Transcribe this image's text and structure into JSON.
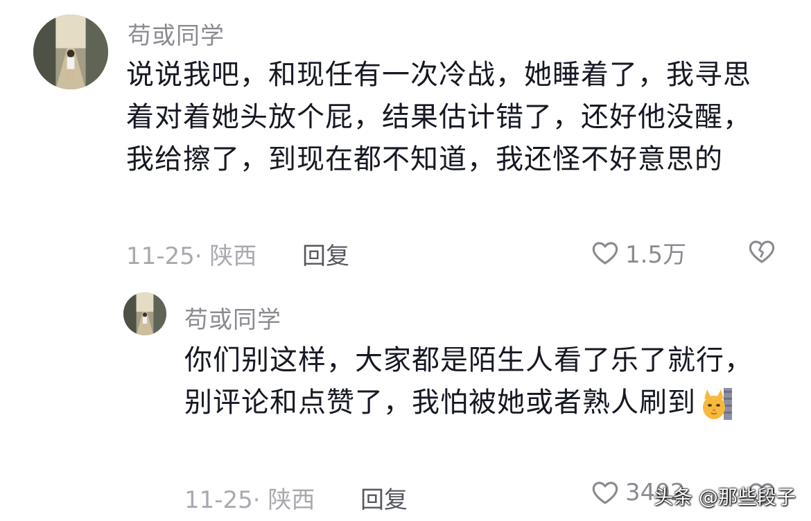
{
  "comments": [
    {
      "username": "苟或同学",
      "text": "说说我吧，和现任有一次冷战，她睡着了，我寻思着对着她头放个屁，结果估计错了，还好他没醒，我给擦了，到现在都不知道，我还怪不好意思的",
      "meta": "11-25· 陕西",
      "reply_label": "回复",
      "likes": "1.5万"
    },
    {
      "username": "苟或同学",
      "text": "你们别这样，大家都是陌生人看了乐了就行，别评论和点赞了，我怕被她或者熟人刷到",
      "meta": "11-25· 陕西",
      "reply_label": "回复",
      "likes": "3402"
    }
  ],
  "watermark": "头条 @那些段子",
  "icons": {
    "like": "heart-outline-icon",
    "dislike": "broken-heart-icon",
    "emoji": "cat-peek-emoji"
  }
}
